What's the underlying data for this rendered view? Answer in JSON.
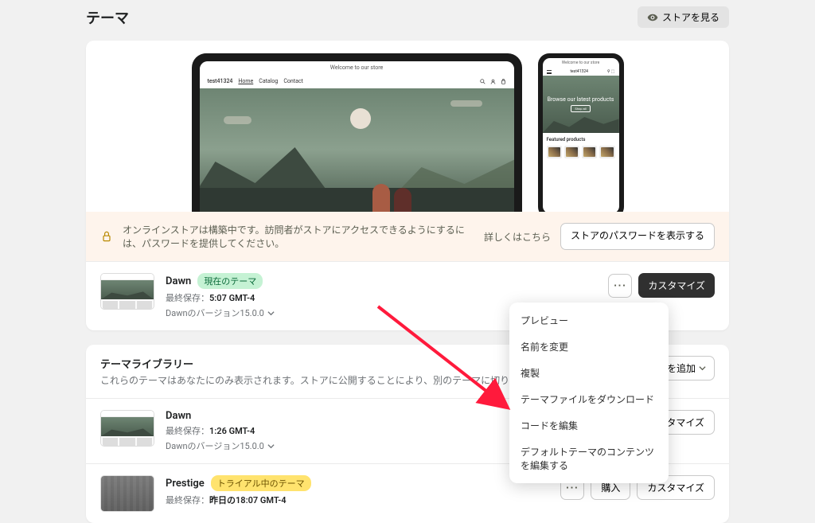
{
  "header": {
    "title": "テーマ",
    "view_store": "ストアを見る"
  },
  "preview": {
    "announcement": "Welcome to our store",
    "store_name": "test41324",
    "nav_home": "Home",
    "nav_catalog": "Catalog",
    "nav_contact": "Contact",
    "mobile_hero": "Browse our latest products",
    "mobile_cta": "Shop all",
    "featured_title": "Featured products"
  },
  "alert": {
    "text": "オンラインストアは構築中です。訪問者がストアにアクセスできるようにするには、パスワードを提供してください。",
    "link": "詳しくはこちら",
    "button": "ストアのパスワードを表示する"
  },
  "current_theme": {
    "name": "Dawn",
    "badge": "現在のテーマ",
    "saved_label": "最終保存：",
    "saved_time": "5:07 GMT-4",
    "version": "Dawnのバージョン15.0.0",
    "customize": "カスタマイズ"
  },
  "library": {
    "title": "テーマライブラリー",
    "desc": "これらのテーマはあなたにのみ表示されます。ストアに公開することにより、別のテーマに切り替えることができます。",
    "add": "テーマを追加",
    "themes": [
      {
        "name": "Dawn",
        "saved_label": "最終保存：",
        "saved_time": "1:26 GMT-4",
        "version": "Dawnのバージョン15.0.0",
        "customize": "カスタマイズ"
      },
      {
        "name": "Prestige",
        "badge": "トライアル中のテーマ",
        "saved_label": "最終保存：",
        "saved_time": "昨日の18:07 GMT-4",
        "buy": "購入",
        "customize": "カスタマイズ"
      }
    ]
  },
  "menu": {
    "preview": "プレビュー",
    "rename": "名前を変更",
    "duplicate": "複製",
    "download": "テーマファイルをダウンロード",
    "edit_code": "コードを編集",
    "edit_default": "デフォルトテーマのコンテンツを編集する"
  }
}
